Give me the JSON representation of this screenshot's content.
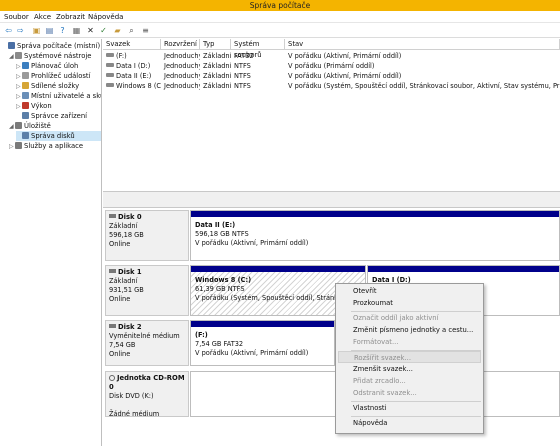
{
  "window": {
    "title": "Správa počítače"
  },
  "menu": [
    "Soubor",
    "Akce",
    "Zobrazit",
    "Nápověda"
  ],
  "toolbar": [
    {
      "icon": "back-arrow-icon",
      "glyph": "⇦",
      "color": "#1e73be"
    },
    {
      "icon": "forward-arrow-icon",
      "glyph": "⇨",
      "color": "#1e73be"
    },
    {
      "icon": "up-folder-icon",
      "glyph": "▣",
      "color": "#c89b3c"
    },
    {
      "icon": "properties-icon",
      "glyph": "▤",
      "color": "#4a6fa5"
    },
    {
      "icon": "help-icon",
      "glyph": "?",
      "color": "#1e73be"
    },
    {
      "icon": "grid-icon",
      "glyph": "▦",
      "color": "#666666"
    },
    {
      "icon": "delete-icon",
      "glyph": "✕",
      "color": "#222222"
    },
    {
      "icon": "checkmark-icon",
      "glyph": "✓",
      "color": "#2e7d32"
    },
    {
      "icon": "open-folder-icon",
      "glyph": "▰",
      "color": "#c89b3c"
    },
    {
      "icon": "search-icon",
      "glyph": "⌕",
      "color": "#444444"
    },
    {
      "icon": "list-icon",
      "glyph": "≡",
      "color": "#555555"
    }
  ],
  "tree": [
    {
      "label": "Správa počítače (místní)",
      "icon": "computer-icon",
      "color": "#4a6fa5",
      "expander": "",
      "level": 0
    },
    {
      "label": "Systémové nástroje",
      "icon": "tools-icon",
      "color": "#8a8a8a",
      "expander": "◢",
      "level": 1
    },
    {
      "label": "Plánovač úloh",
      "icon": "clock-icon",
      "color": "#3c7fc0",
      "expander": "▷",
      "level": 2
    },
    {
      "label": "Prohlížeč událostí",
      "icon": "event-viewer-icon",
      "color": "#9a9a9a",
      "expander": "▷",
      "level": 2
    },
    {
      "label": "Sdílené složky",
      "icon": "shared-folder-icon",
      "color": "#d6a536",
      "expander": "▷",
      "level": 2
    },
    {
      "label": "Místní uživatelé a skupiny",
      "icon": "users-icon",
      "color": "#6a8fb8",
      "expander": "▷",
      "level": 2
    },
    {
      "label": "Výkon",
      "icon": "performance-icon",
      "color": "#c0392b",
      "expander": "▷",
      "level": 2
    },
    {
      "label": "Správce zařízení",
      "icon": "device-manager-icon",
      "color": "#5b7fa8",
      "expander": "",
      "level": 2
    },
    {
      "label": "Úložiště",
      "icon": "storage-icon",
      "color": "#7a7a7a",
      "expander": "◢",
      "level": 1
    },
    {
      "label": "Správa disků",
      "icon": "disk-management-icon",
      "color": "#5b7fa8",
      "expander": "",
      "level": 2,
      "selected": true
    },
    {
      "label": "Služby a aplikace",
      "icon": "services-icon",
      "color": "#7a7a7a",
      "expander": "▷",
      "level": 1
    }
  ],
  "volumes": {
    "headers": [
      "Svazek",
      "Rozvržení",
      "Typ",
      "Systém souborů",
      "Stav"
    ],
    "rows": [
      [
        "(F:)",
        "Jednoduchý",
        "Základní",
        "FAT32",
        "V pořádku (Aktivní, Primární oddíl)"
      ],
      [
        "Data I (D:)",
        "Jednoduchý",
        "Základní",
        "NTFS",
        "V pořádku (Primární oddíl)"
      ],
      [
        "Data II (E:)",
        "Jednoduchý",
        "Základní",
        "NTFS",
        "V pořádku (Aktivní, Primární oddíl)"
      ],
      [
        "Windows 8 (C:)",
        "Jednoduchý",
        "Základní",
        "NTFS",
        "V pořádku (Systém, Spouštěcí oddíl, Stránkovací soubor, Aktivní, Stav systému, Primární oddíl)"
      ]
    ]
  },
  "disks": [
    {
      "name": "Disk 0",
      "lines": [
        "Základní",
        "596,18 GB",
        "Online"
      ],
      "icon": "disk-icon"
    },
    {
      "name": "Disk 1",
      "lines": [
        "Základní",
        "931,51 GB",
        "Online"
      ],
      "icon": "disk-icon"
    },
    {
      "name": "Disk 2",
      "lines": [
        "Vyměnitelné médium",
        "7,54 GB",
        "Online"
      ],
      "icon": "disk-icon"
    },
    {
      "name": "Jednotka CD-ROM 0",
      "lines": [
        "Disk DVD (K:)",
        "",
        "Žádné médium"
      ],
      "icon": "cdrom-icon"
    }
  ],
  "partitions": {
    "disk0": {
      "name": "Data II  (E:)",
      "size": "596,18 GB NTFS",
      "status": "V pořádku (Aktivní, Primární oddíl)"
    },
    "disk1a": {
      "name": "Windows 8  (C:)",
      "size": "61,39 GB NTFS",
      "status": "V pořádku (Systém, Spouštěcí oddíl, Stránkovací sou"
    },
    "disk1b": {
      "name": "Data I  (D:)"
    },
    "disk2": {
      "name": "(F:)",
      "size": "7,54 GB FAT32",
      "status": "V pořádku (Aktivní, Primární oddíl)"
    }
  },
  "context_menu": [
    {
      "label": "Otevřít",
      "enabled": true
    },
    {
      "label": "Prozkoumat",
      "enabled": true
    },
    {
      "sep": true
    },
    {
      "label": "Označit oddíl jako aktivní",
      "enabled": false
    },
    {
      "label": "Změnit písmeno jednotky a cestu...",
      "enabled": true
    },
    {
      "label": "Formátovat...",
      "enabled": false
    },
    {
      "sep": true
    },
    {
      "label": "Rozšířit svazek...",
      "enabled": false,
      "highlighted": true
    },
    {
      "label": "Zmenšit svazek...",
      "enabled": true
    },
    {
      "label": "Přidat zrcadlo...",
      "enabled": false
    },
    {
      "label": "Odstranit svazek...",
      "enabled": false
    },
    {
      "sep": true
    },
    {
      "label": "Vlastnosti",
      "enabled": true
    },
    {
      "sep": true
    },
    {
      "label": "Nápověda",
      "enabled": true
    }
  ]
}
